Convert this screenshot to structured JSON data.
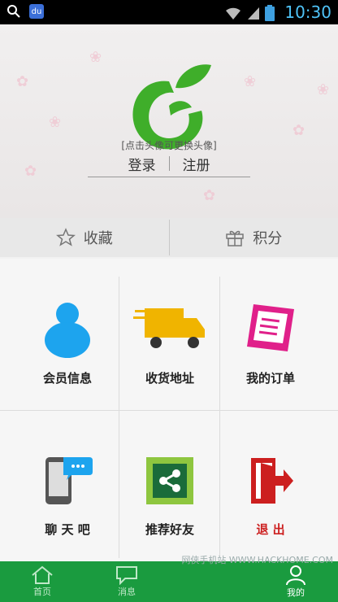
{
  "status": {
    "time": "10:30"
  },
  "header": {
    "avatar_hint": "[点击头像可更换头像]",
    "login": "登录",
    "register": "注册"
  },
  "tabs": [
    {
      "label": "收藏"
    },
    {
      "label": "积分"
    }
  ],
  "grid": [
    {
      "label": "会员信息"
    },
    {
      "label": "收货地址"
    },
    {
      "label": "我的订单"
    },
    {
      "label": "聊 天 吧"
    },
    {
      "label": "推荐好友"
    },
    {
      "label": "退 出",
      "color": "#cc1f1f"
    }
  ],
  "bottom_nav": [
    {
      "label": "首页"
    },
    {
      "label": "消息"
    },
    {
      "label": "我的"
    }
  ],
  "watermark": "网侠手机站 WWW.HACKHOME.COM",
  "colors": {
    "brand_green": "#1a9b3f",
    "exit_red": "#cc1f1f"
  }
}
